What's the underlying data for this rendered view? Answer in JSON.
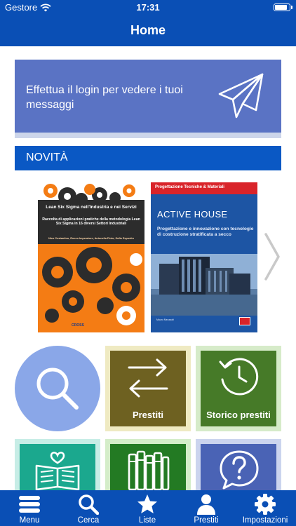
{
  "status_bar": {
    "carrier": "Gestore",
    "time": "17:31",
    "battery_level": 0.9
  },
  "header": {
    "title": "Home"
  },
  "login_banner": {
    "message": "Effettua il login per vedere i tuoi messaggi",
    "icon": "paper-plane-icon"
  },
  "news": {
    "title": "NOVITÀ",
    "books": [
      {
        "title": "Lean Six Sigma nell'Industria e nei Servizi",
        "subtitle": "Raccolta di applicazioni pratiche della metodologia Lean Six Sigma in 16 diversi Settori Industriali",
        "authors": "Nico Costantino, Rocco Imperatore, Antonella Pinto, Sofia Esposito",
        "publisher": "CROSS"
      },
      {
        "series": "Progettazione Tecniche & Materiali",
        "title": "ACTIVE HOUSE",
        "subtitle": "Progettazione e innovazione con tecnologie di costruzione stratificata a secco",
        "author": "Mauro Mezzadri"
      }
    ],
    "next_icon": "chevron-right-icon"
  },
  "tiles": {
    "search": {
      "icon": "magnifier-icon"
    },
    "loans": {
      "label": "Prestiti",
      "icon": "swap-arrows-icon",
      "color": "#6e6121"
    },
    "history": {
      "label": "Storico prestiti",
      "icon": "history-clock-icon",
      "color": "#467a28"
    },
    "row2": [
      {
        "icon": "open-book-heart-icon",
        "color": "#1ba88e"
      },
      {
        "icon": "bookshelf-icon",
        "color": "#237a23"
      },
      {
        "icon": "help-bubble-icon",
        "color": "#4a63b5"
      }
    ]
  },
  "tab_bar": {
    "items": [
      {
        "label": "Menu",
        "icon": "menu-icon"
      },
      {
        "label": "Cerca",
        "icon": "search-icon"
      },
      {
        "label": "Liste",
        "icon": "star-icon"
      },
      {
        "label": "Prestiti",
        "icon": "user-icon"
      },
      {
        "label": "Impostazioni",
        "icon": "gear-icon"
      }
    ]
  },
  "colors": {
    "primary": "#0a4fb5",
    "banner": "#5a73c4",
    "section": "#0a58c4"
  }
}
